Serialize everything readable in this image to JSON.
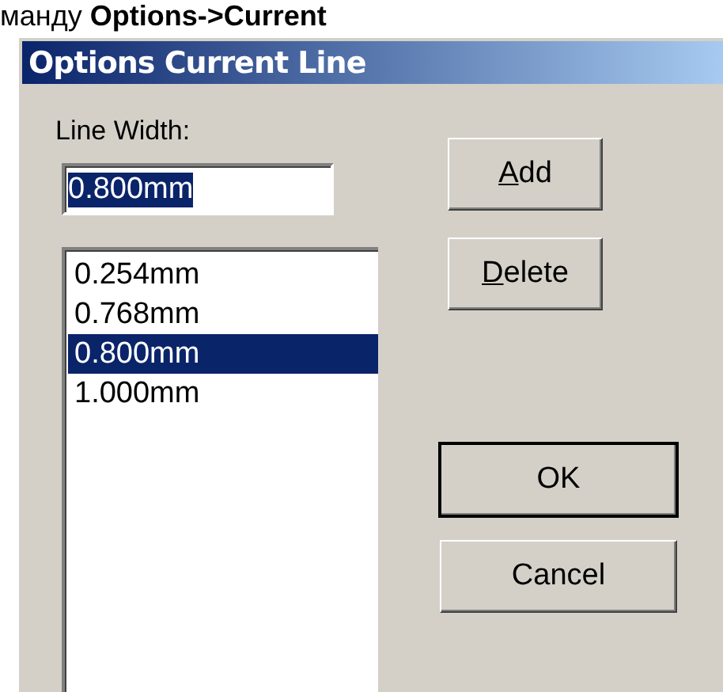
{
  "document_text": "манду **Options->Current**",
  "window": {
    "title": "Options Current Line"
  },
  "line_width": {
    "label": "Line Width:",
    "value": "0.800mm"
  },
  "widths": [
    {
      "label": "0.254mm",
      "selected": false
    },
    {
      "label": "0.768mm",
      "selected": false
    },
    {
      "label": "0.800mm",
      "selected": true
    },
    {
      "label": "1.000mm",
      "selected": false
    }
  ],
  "side_buttons": [
    {
      "access_key": "A",
      "label_rest": "dd"
    },
    {
      "access_key": "D",
      "label_rest": "elete"
    }
  ],
  "buttons": [
    {
      "label": "OK",
      "default": true
    },
    {
      "label": "Cancel",
      "default": false
    }
  ]
}
